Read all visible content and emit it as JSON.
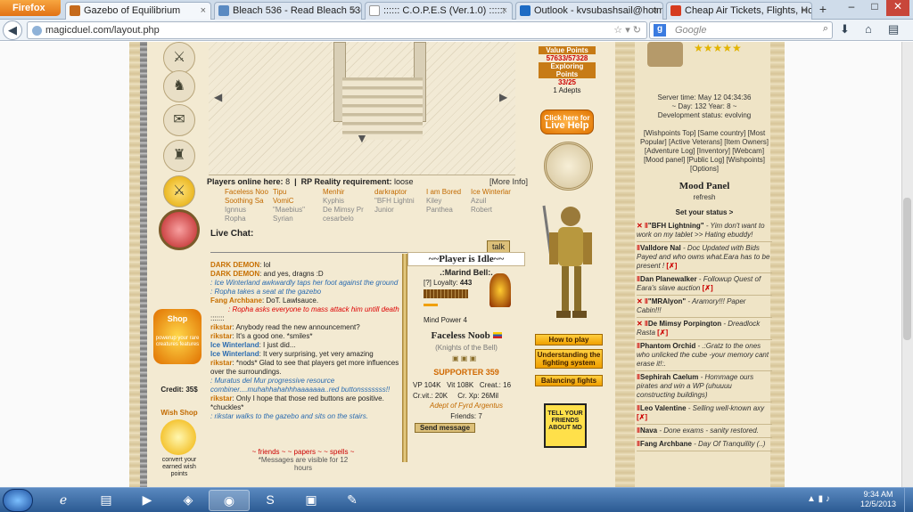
{
  "browser": {
    "menu_button": "Firefox",
    "tabs": [
      {
        "label": "Gazebo of Equilibrium",
        "active": true,
        "color": "#c56a1c"
      },
      {
        "label": "Bleach 536 - Read Bleach 536 Pa...",
        "active": false,
        "color": "#5a8ac2"
      },
      {
        "label": ":::::: C.O.P.E.S (Ver.1.0) ::::::",
        "active": false,
        "color": "#ffffff"
      },
      {
        "label": "Outlook - kvsubashsail@hotmai...",
        "active": false,
        "color": "#1d6bc4"
      },
      {
        "label": "Cheap Air Tickets, Flights, Hotel...",
        "active": false,
        "color": "#d63b1f"
      }
    ],
    "url": "magicduel.com/layout.php",
    "search_placeholder": "Google",
    "window_controls": [
      "–",
      "□",
      "✕"
    ]
  },
  "page": {
    "value_points_label": "Value Points",
    "value_points": "57633/57328",
    "exploring_points_label": "Exploring Points",
    "exploring_points": "33/25",
    "adepts": "1 Adepts",
    "live_help_small": "Click here for",
    "live_help": "Live Help",
    "players_online_label": "Players online here:",
    "players_online": "8",
    "rp_label": "RP Reality requirement:",
    "rp_value": "loose",
    "more_info": "[More Info]",
    "players": [
      {
        "name": "Faceless Noo",
        "on": true
      },
      {
        "name": "Tipu",
        "on": true
      },
      {
        "name": "Menhir",
        "on": true
      },
      {
        "name": "darkraptor",
        "on": true
      },
      {
        "name": "I am Bored",
        "on": true
      },
      {
        "name": "Ice Winterlar",
        "on": true
      },
      {
        "name": "Soothing Sa",
        "on": true
      },
      {
        "name": "VomiC",
        "on": true
      },
      {
        "name": "Kyphis",
        "on": false
      },
      {
        "name": "\"BFH Lightni",
        "on": false
      },
      {
        "name": "Kiley",
        "on": false
      },
      {
        "name": "Azuil",
        "on": false
      },
      {
        "name": "Ignnus",
        "on": false
      },
      {
        "name": "\"Maebius\"",
        "on": false
      },
      {
        "name": "De Mimsy Pr",
        "on": false
      },
      {
        "name": "Junior",
        "on": false
      },
      {
        "name": "Panthea",
        "on": false
      },
      {
        "name": "Robert",
        "on": false
      },
      {
        "name": "Ropha",
        "on": false
      },
      {
        "name": "Syrian",
        "on": false
      },
      {
        "name": "cesarbelo",
        "on": false
      }
    ],
    "live_chat": "Live Chat:",
    "talk_button": "talk",
    "chat": [
      {
        "name": "DARK DEMON",
        "type": "n1",
        "text": ": lol"
      },
      {
        "name": "DARK DEMON",
        "type": "n1",
        "text": ": and yes, dragns :D"
      },
      {
        "name": "",
        "type": "act",
        "text": ": Ice Winterland awkwardly taps her foot against the ground"
      },
      {
        "name": "",
        "type": "act",
        "text": ": Ropha takes a seat at the gazebo"
      },
      {
        "name": "Fang Archbane",
        "type": "n1",
        "text": ": DoT. Lawlsauce."
      },
      {
        "name": "",
        "type": "red",
        "text": ": Ropha asks everyone to mass attack him untill death"
      },
      {
        "name": "",
        "type": "plain",
        "text": ":::::::"
      },
      {
        "name": "rikstar",
        "type": "n1",
        "text": ": Anybody read the new announcement?"
      },
      {
        "name": "rikstar",
        "type": "n1",
        "text": ": It's a good one. *smiles*"
      },
      {
        "name": "Ice Winterland",
        "type": "n2",
        "text": ": I just did..."
      },
      {
        "name": "Ice Winterland",
        "type": "n2",
        "text": ": It very surprising, yet very amazing"
      },
      {
        "name": "rikstar",
        "type": "n1",
        "text": ": *nods* Glad to see that players get more influences over the surroundings."
      },
      {
        "name": "",
        "type": "act",
        "text": ": Muratus del Mur progressive resource combiner....muhahhahahhhaaaaaaa..red buttonsssssss!!"
      },
      {
        "name": "rikstar",
        "type": "n1",
        "text": ": Only I hope that those red buttons are positive. *chuckles*"
      },
      {
        "name": "",
        "type": "act",
        "text": ": rikstar walks to the gazebo and sits on the stairs."
      }
    ],
    "chat_links": "~ friends ~ ~ papers ~ ~ spells ~",
    "chat_note": "*Messages are visible for 12 hours",
    "idle_title": "~~Player is Idle~~",
    "idle_sub": ".:Marind Bell:.",
    "loyalty_label": "[?] Loyalty:",
    "loyalty": "443",
    "mind_power": "Mind Power 4",
    "player_name": "Faceless Noob",
    "player_guild": "(Knights of the Bell)",
    "supporter": "SUPPORTER 359",
    "stats": {
      "vp": "VP 104K",
      "vit": "Vit 108K",
      "creat": "Creat.: 16",
      "crvit": "Cr.vit.: 20K",
      "crxp": "Cr. Xp: 26Mil"
    },
    "adept_of": "Adept of Fyrd Argentus",
    "friends": "Friends: 7",
    "send_message": "Send message",
    "how_to_play": "How to play",
    "understanding": "Understanding the fighting system",
    "balancing": "Balancing fights",
    "tell_friends": "TELL YOUR FRIENDS ABOUT MD",
    "shop_label": "Shop",
    "shop_sub": "powerup your rare creatures features",
    "credit": "Credit: 35$",
    "wish_shop": "Wish Shop",
    "wish_sub": "convert your earned wish points"
  },
  "right": {
    "server_time": "Server time: May 12 04:34:36",
    "day_year": "~ Day: 132 Year: 8 ~",
    "dev_status": "Development status: evolving",
    "links": "[Wishpoints Top] [Same country] [Most Popular] [Active Veterans] [Item Owners] [Adventure Log] [Inventory] [Webcam] [Mood panel] [Public Log] [Wishpoints] [Options]",
    "mood_panel": "Mood Panel",
    "refresh": "refresh",
    "set_status": "Set your status >",
    "moods": [
      {
        "name": "\"BFH Lightning\"",
        "text": " - Yim don't want to work on my tablet >> Hating ebuddy!",
        "flag": ""
      },
      {
        "name": "Valldore Nal",
        "text": " - Doc Updated with Bids Payed and who owns what.Eara has to be present !",
        "flag": "[✗]"
      },
      {
        "name": "Dan Planewalker",
        "text": " - Followup Quest of Eara's slave auction",
        "flag": "[✗]"
      },
      {
        "name": "\"MRAlyon\"",
        "text": " - Aramory!!! Paper Cabin!!!",
        "flag": ""
      },
      {
        "name": "De Mimsy Porpington",
        "text": " - Dreadlock Rasta",
        "flag": "[✗]"
      },
      {
        "name": "Phantom Orchid",
        "text": " - .:Gratz to the ones who unlicked the cube -your memory cant erase it!:.",
        "flag": ""
      },
      {
        "name": "Sephirah Caelum",
        "text": " - Hommage ours pirates and win a WP (uhuuuu constructing buildings)",
        "flag": ""
      },
      {
        "name": "Leo Valentine",
        "text": " - Selling well-known axy",
        "flag": "[✗]"
      },
      {
        "name": "Nava",
        "text": " - Done exams - sanity restored.",
        "flag": ""
      },
      {
        "name": "Fang Archbane",
        "text": " - Day Of Tranquility (..)",
        "flag": ""
      }
    ]
  },
  "taskbar": {
    "time": "9:34 AM",
    "date": "12/5/2013"
  }
}
